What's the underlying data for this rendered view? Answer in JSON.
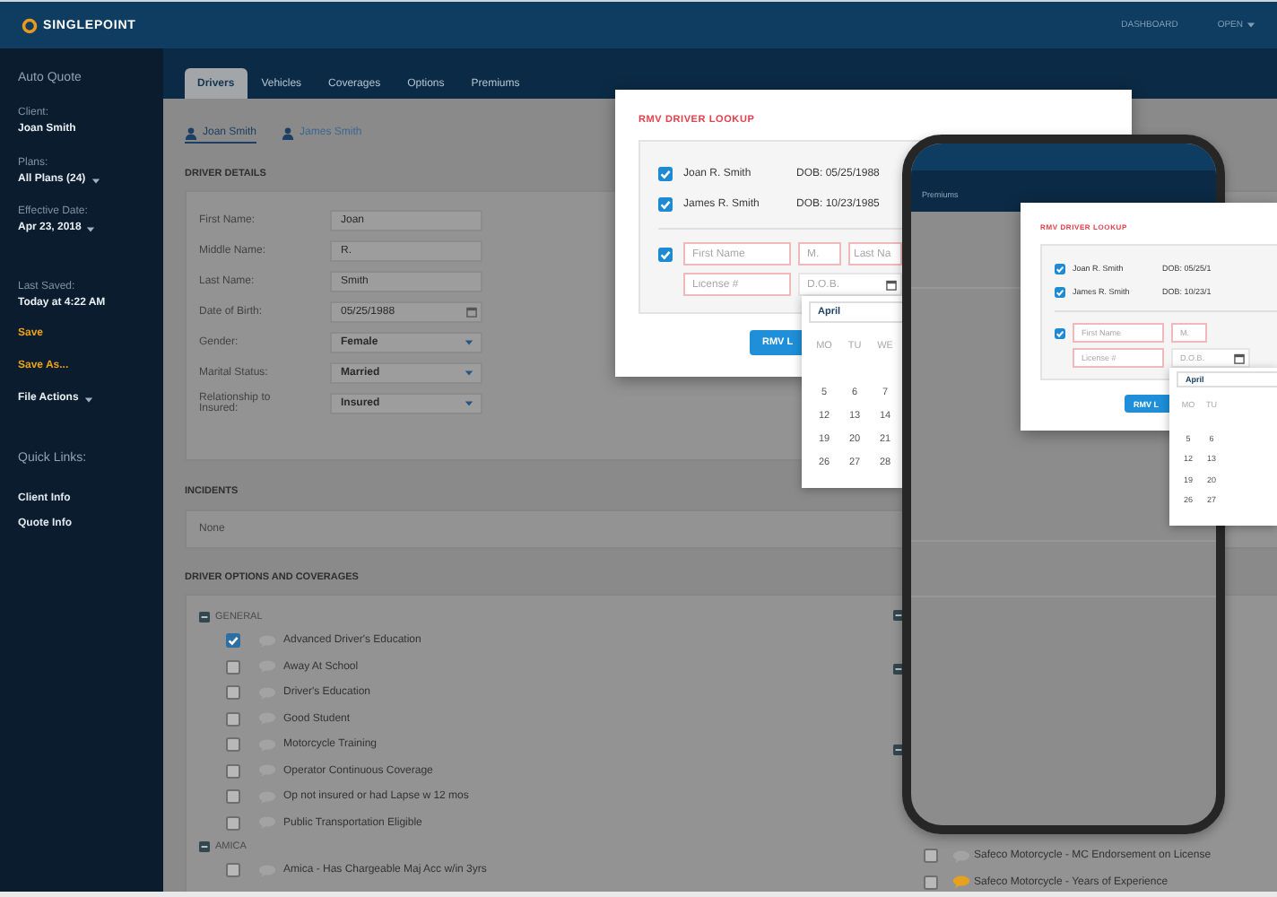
{
  "header": {
    "logo": "SINGLEPOINT",
    "nav": [
      {
        "label": "DASHBOARD",
        "menu": false
      },
      {
        "label": "OPEN",
        "menu": true
      }
    ]
  },
  "sidebar": {
    "title": "Auto Quote",
    "fields": [
      {
        "label": "Client:",
        "value": "Joan Smith",
        "menu": false
      },
      {
        "label": "Plans:",
        "value": "All Plans (24)",
        "menu": true
      },
      {
        "label": "Effective Date:",
        "value": "Apr 23, 2018",
        "menu": true
      }
    ],
    "last_saved": {
      "label": "Last Saved:",
      "value": "Today at 4:22 AM"
    },
    "actions": [
      {
        "label": "Save",
        "kind": "link"
      },
      {
        "label": "Save As...",
        "kind": "link"
      },
      {
        "label": "File Actions",
        "kind": "menu"
      }
    ],
    "quick_links": {
      "title": "Quick Links:",
      "items": [
        "Client Info",
        "Quote Info"
      ]
    }
  },
  "tabs": [
    {
      "label": "Drivers",
      "selected": true
    },
    {
      "label": "Vehicles",
      "selected": false
    },
    {
      "label": "Coverages",
      "selected": false
    },
    {
      "label": "Options",
      "selected": false
    },
    {
      "label": "Premiums",
      "selected": false
    }
  ],
  "drivers": [
    {
      "name": "Joan Smith",
      "selected": true
    },
    {
      "name": "James Smith",
      "selected": false
    }
  ],
  "driver_details": {
    "title": "DRIVER DETAILS",
    "fields": [
      {
        "label": "First Name:",
        "value": "Joan",
        "kind": "text"
      },
      {
        "label": "Middle Name:",
        "value": "R.",
        "kind": "text"
      },
      {
        "label": "Last Name:",
        "value": "Smith",
        "kind": "text"
      },
      {
        "label": "Date of Birth:",
        "value": "05/25/1988",
        "kind": "date"
      },
      {
        "label": "Gender:",
        "value": "Female",
        "kind": "select"
      },
      {
        "label": "Marital Status:",
        "value": "Married",
        "kind": "select"
      },
      {
        "label": "Relationship to Insured:",
        "value": "Insured",
        "kind": "select"
      }
    ]
  },
  "incidents": {
    "title": "INCIDENTS",
    "text": "None"
  },
  "coverages": {
    "title": "DRIVER OPTIONS AND COVERAGES",
    "groups": [
      {
        "name": "GENERAL",
        "expanded": true,
        "items": [
          {
            "label": "Advanced Driver's Education",
            "checked": true,
            "note": false
          },
          {
            "label": "Away At School",
            "checked": false,
            "note": false
          },
          {
            "label": "Driver's Education",
            "checked": false,
            "note": false
          },
          {
            "label": "Good Student",
            "checked": false,
            "note": false
          },
          {
            "label": "Motorcycle Training",
            "checked": false,
            "note": false
          },
          {
            "label": "Operator Continuous Coverage",
            "checked": false,
            "note": false
          },
          {
            "label": "Op not insured or had Lapse w 12 mos",
            "checked": false,
            "note": false
          },
          {
            "label": "Public Transportation Eligible",
            "checked": false,
            "note": false
          }
        ]
      },
      {
        "name": "AMICA",
        "expanded": true,
        "items": [
          {
            "label": "Amica - Has Chargeable Maj Acc w/in 3yrs",
            "checked": false,
            "note": false
          }
        ]
      }
    ],
    "right_groups": [
      {
        "expanded": true
      },
      {
        "expanded": true
      },
      {
        "expanded": true
      }
    ],
    "right_items": [
      {
        "label": "Safeco Motorcycle - MC Endorsement on License",
        "checked": false,
        "note": false
      },
      {
        "label": "Safeco Motorcycle - Years of Experience",
        "checked": false,
        "note": true
      }
    ]
  },
  "lookup": {
    "title": "RMV DRIVER LOOKUP",
    "matches": [
      {
        "name": "Joan R. Smith",
        "dob": "DOB: 05/25/1988",
        "checked": true
      },
      {
        "name": "James R. Smith",
        "dob": "DOB: 10/23/1985",
        "checked": true
      }
    ],
    "manual_checked": true,
    "field_rows": [
      [
        {
          "placeholder": "First Name",
          "kind": "text"
        },
        {
          "placeholder": "M.",
          "kind": "text"
        },
        {
          "placeholder": "Last Na",
          "kind": "text"
        }
      ],
      [
        {
          "placeholder": "License #",
          "kind": "text"
        },
        {
          "placeholder": "D.O.B.",
          "kind": "date"
        }
      ]
    ],
    "button": "RMV L"
  },
  "calendar": {
    "month": "April",
    "weekdays": [
      "MO",
      "TU",
      "WE"
    ],
    "weeks": [
      [
        "5",
        "6",
        "7"
      ],
      [
        "12",
        "13",
        "14"
      ],
      [
        "19",
        "20",
        "21"
      ],
      [
        "26",
        "27",
        "28"
      ]
    ]
  },
  "phone": {
    "tab_label": "Premiums",
    "lookup": {
      "title": "RMV DRIVER LOOKUP",
      "matches": [
        {
          "name": "Joan R. Smith",
          "dob": "DOB: 05/25/1",
          "checked": true
        },
        {
          "name": "James R. Smith",
          "dob": "DOB: 10/23/1",
          "checked": true
        }
      ],
      "manual_checked": true,
      "field_rows": [
        [
          {
            "placeholder": "First Name",
            "kind": "text"
          },
          {
            "placeholder": "M.",
            "kind": "text"
          }
        ],
        [
          {
            "placeholder": "License #",
            "kind": "text"
          },
          {
            "placeholder": "D.O.B.",
            "kind": "date"
          }
        ]
      ],
      "button": "RMV L"
    },
    "calendar": {
      "month": "April",
      "weekdays": [
        "MO",
        "TU"
      ],
      "weeks": [
        [
          "5",
          "6"
        ],
        [
          "12",
          "13"
        ],
        [
          "19",
          "20"
        ],
        [
          "26",
          "27"
        ]
      ]
    }
  }
}
